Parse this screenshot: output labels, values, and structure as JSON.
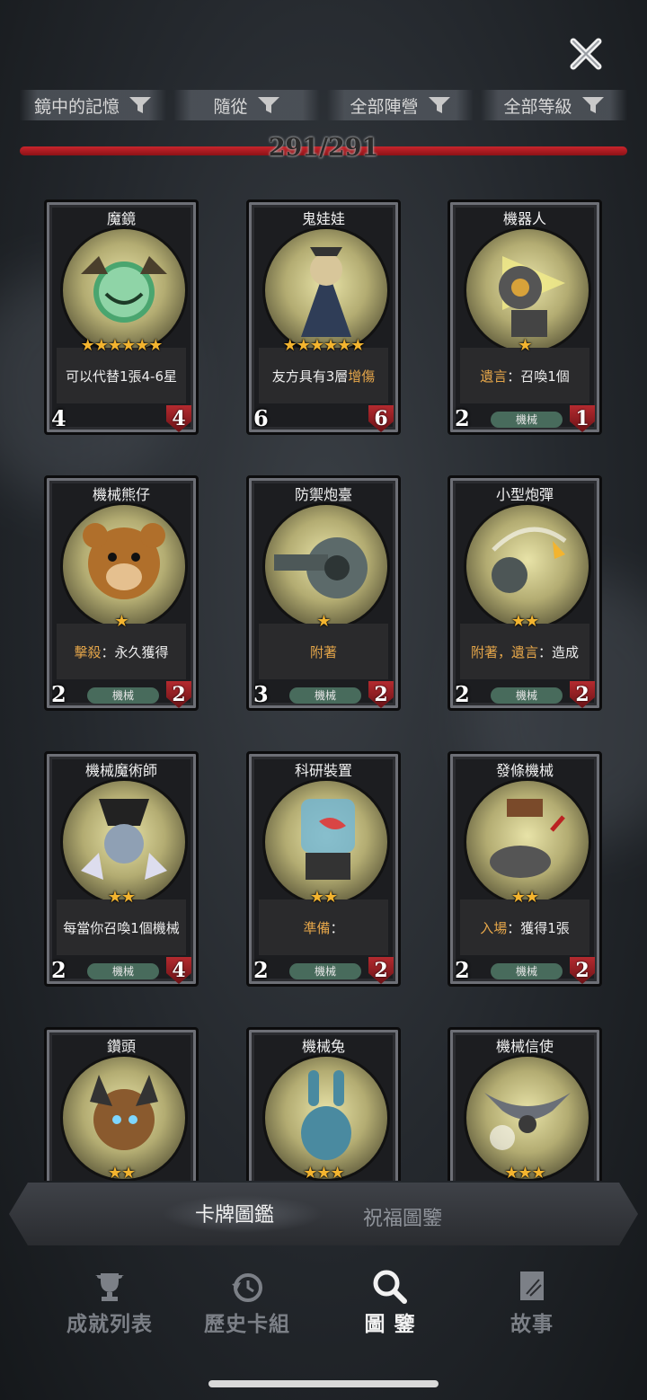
{
  "filters": [
    {
      "label": "鏡中的記憶"
    },
    {
      "label": "隨從"
    },
    {
      "label": "全部陣營"
    },
    {
      "label": "全部等級"
    }
  ],
  "progress": {
    "text": "291/291",
    "fraction": 1.0
  },
  "cards": [
    {
      "name": "魔鏡",
      "stars": "★★★★★★",
      "desc_pre": "可以代替1張4-6星",
      "desc_kw": "",
      "desc_post": "",
      "attack": "4",
      "health": "4",
      "tag": ""
    },
    {
      "name": "鬼娃娃",
      "stars": "★★★★★★",
      "desc_pre": "友方具有3層",
      "desc_kw": "增傷",
      "desc_post": "",
      "attack": "6",
      "health": "6",
      "tag": ""
    },
    {
      "name": "機器人",
      "stars": "★",
      "desc_pre": "",
      "desc_kw": "遺言",
      "desc_post": "：召喚1個",
      "attack": "2",
      "health": "1",
      "tag": "機械"
    },
    {
      "name": "機械熊仔",
      "stars": "★",
      "desc_pre": "",
      "desc_kw": "擊殺",
      "desc_post": "：永久獲得",
      "attack": "2",
      "health": "2",
      "tag": "機械"
    },
    {
      "name": "防禦炮臺",
      "stars": "★",
      "desc_pre": "",
      "desc_kw": "附著",
      "desc_post": "",
      "attack": "3",
      "health": "2",
      "tag": "機械"
    },
    {
      "name": "小型炮彈",
      "stars": "★★",
      "desc_pre": "",
      "desc_kw": "附著，遺言",
      "desc_post": "：造成",
      "attack": "2",
      "health": "2",
      "tag": "機械"
    },
    {
      "name": "機械魔術師",
      "stars": "★★",
      "desc_pre": "每當你召喚1個機械",
      "desc_kw": "",
      "desc_post": "",
      "attack": "2",
      "health": "4",
      "tag": "機械"
    },
    {
      "name": "科研裝置",
      "stars": "★★",
      "desc_pre": "",
      "desc_kw": "準備",
      "desc_post": "：",
      "attack": "2",
      "health": "2",
      "tag": "機械"
    },
    {
      "name": "發條機械",
      "stars": "★★",
      "desc_pre": "",
      "desc_kw": "入場",
      "desc_post": "：獲得1張",
      "attack": "2",
      "health": "2",
      "tag": "機械"
    },
    {
      "name": "鑽頭",
      "stars": "★★",
      "desc_pre": "",
      "desc_kw": "",
      "desc_post": "",
      "attack": "",
      "health": "",
      "tag": ""
    },
    {
      "name": "機械兔",
      "stars": "★★★",
      "desc_pre": "",
      "desc_kw": "",
      "desc_post": "",
      "attack": "",
      "health": "",
      "tag": ""
    },
    {
      "name": "機械信使",
      "stars": "★★★",
      "desc_pre": "",
      "desc_kw": "",
      "desc_post": "",
      "attack": "",
      "health": "",
      "tag": ""
    }
  ],
  "tabs": {
    "active": "卡牌圖鑑",
    "inactive": "祝福圖鑒"
  },
  "nav": [
    {
      "label": "成就列表",
      "icon": "trophy-icon"
    },
    {
      "label": "歷史卡組",
      "icon": "history-icon"
    },
    {
      "label": "圖 鑒",
      "icon": "magnifier-icon"
    },
    {
      "label": "故事",
      "icon": "book-icon"
    }
  ],
  "colors": {
    "accent_red": "#c9252c",
    "star": "#f3b42f",
    "keyword": "#e5a64a",
    "tag_bg": "#486b5c"
  }
}
